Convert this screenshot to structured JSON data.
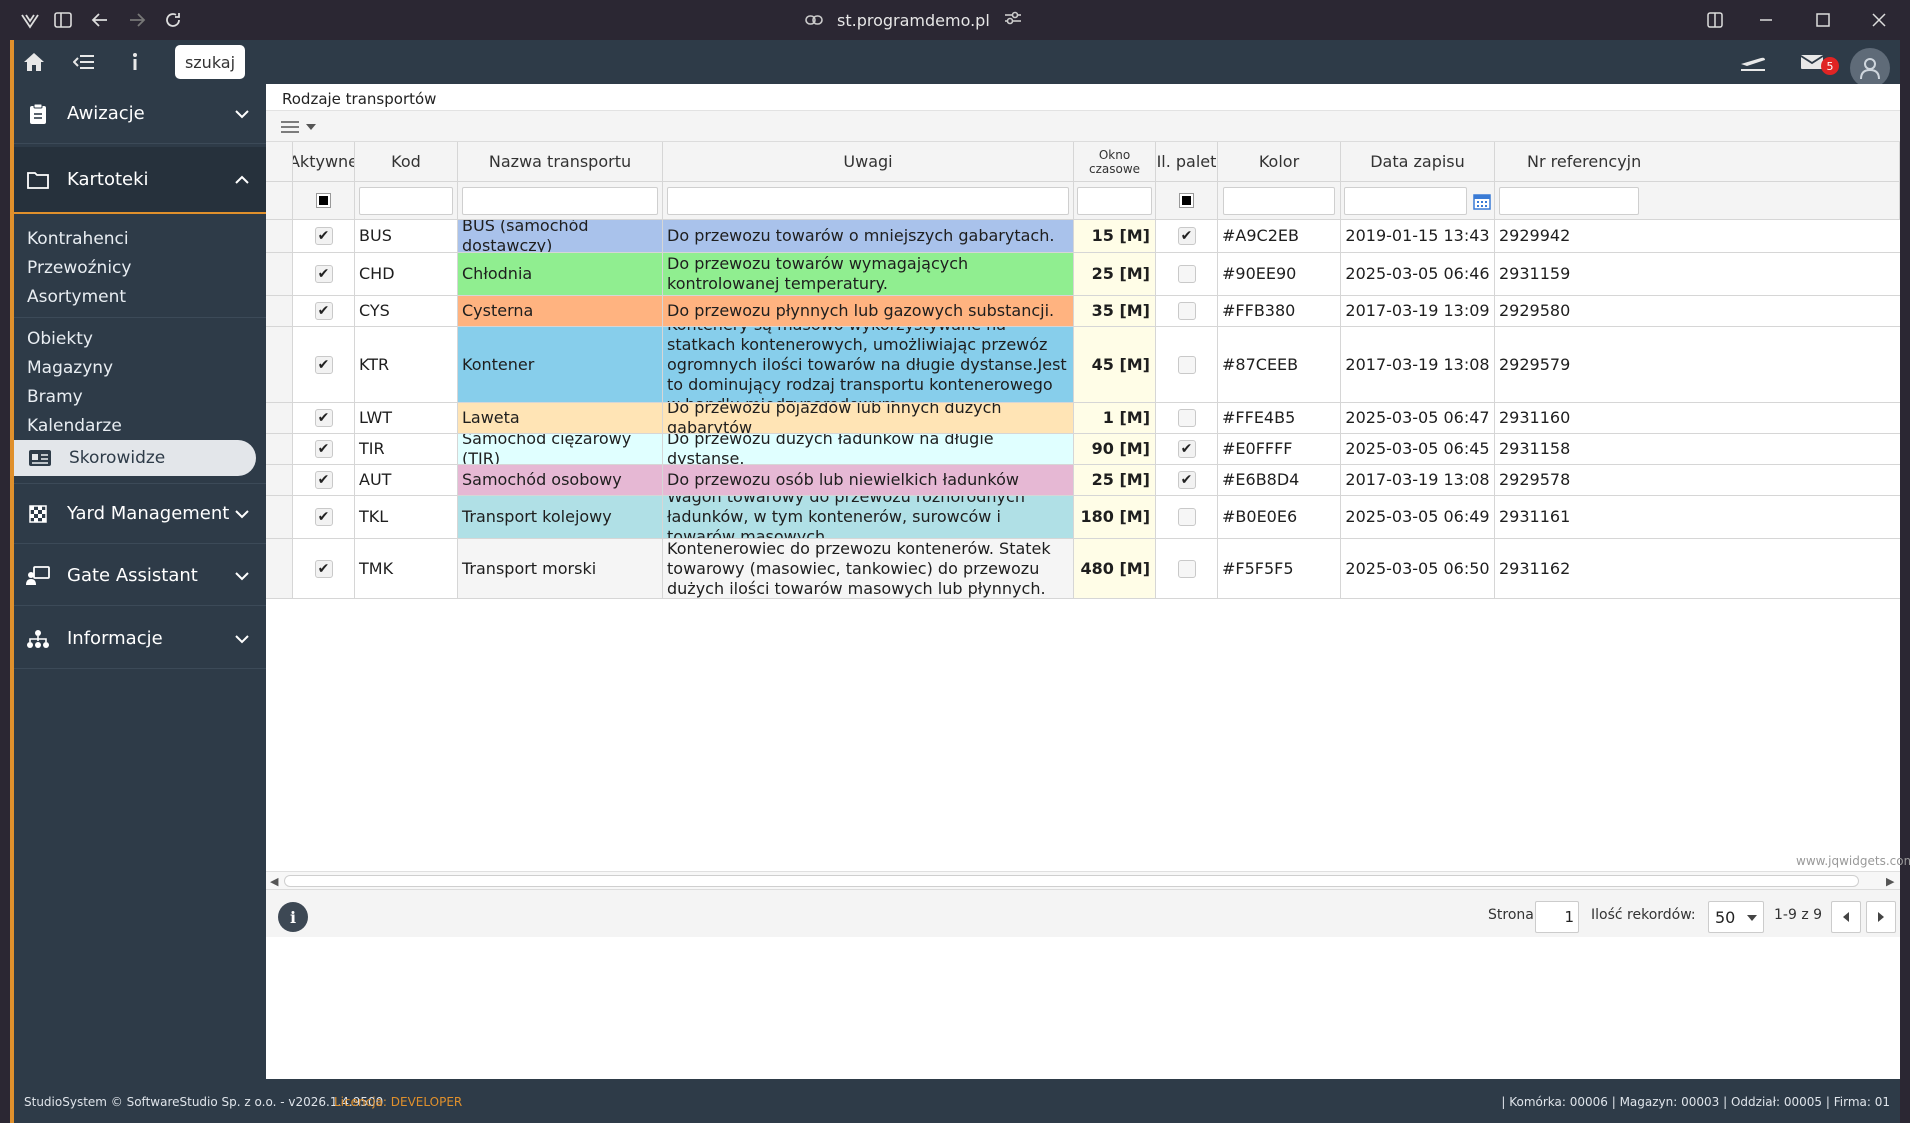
{
  "browser": {
    "url": "st.programdemo.pl"
  },
  "topbar": {
    "search_label": "szukaj",
    "mail_count": "5"
  },
  "sidebar": {
    "sections": [
      {
        "label": "Awizacje",
        "icon": "clipboard-icon"
      },
      {
        "label": "Kartoteki",
        "icon": "folder-icon"
      },
      {
        "label": "Yard Management",
        "icon": "checker-icon"
      },
      {
        "label": "Gate Assistant",
        "icon": "gate-icon"
      },
      {
        "label": "Informacje",
        "icon": "hierarchy-icon"
      }
    ],
    "kartoteki_items": [
      "Kontrahenci",
      "Przewoźnicy",
      "Asortyment",
      "Obiekty",
      "Magazyny",
      "Bramy",
      "Kalendarze"
    ],
    "active_item": "Skorowidze"
  },
  "page": {
    "title": "Rodzaje transportów"
  },
  "grid": {
    "columns": [
      "Aktywne",
      "Kod",
      "Nazwa transportu",
      "Uwagi",
      "Okno czasowe",
      "Il. palet",
      "Kolor",
      "Data zapisu",
      "Nr referencyjn"
    ],
    "rows": [
      {
        "aktywne": true,
        "kod": "BUS",
        "nazwa": "BUS (samochód dostawczy)",
        "uwagi": "Do przewozu towarów o mniejszych gabarytach.",
        "okno": "15 [M]",
        "palety": true,
        "kolor": "#A9C2EB",
        "data": "2019-01-15 13:43",
        "nr": "2929942"
      },
      {
        "aktywne": true,
        "kod": "CHD",
        "nazwa": "Chłodnia",
        "uwagi": "Do przewozu towarów wymagających kontrolowanej temperatury.",
        "okno": "25 [M]",
        "palety": false,
        "kolor": "#90EE90",
        "data": "2025-03-05 06:46",
        "nr": "2931159"
      },
      {
        "aktywne": true,
        "kod": "CYS",
        "nazwa": "Cysterna",
        "uwagi": "Do przewozu płynnych lub gazowych substancji.",
        "okno": "35 [M]",
        "palety": false,
        "kolor": "#FFB380",
        "data": "2017-03-19 13:09",
        "nr": "2929580"
      },
      {
        "aktywne": true,
        "kod": "KTR",
        "nazwa": "Kontener",
        "uwagi": "Kontenery są masowo wykorzystywane na statkach kontenerowych, umożliwiając przewóz ogromnych ilości towarów na długie dystanse.Jest to dominujący rodzaj transportu kontenerowego w handlu międzynarodowym.",
        "okno": "45 [M]",
        "palety": false,
        "kolor": "#87CEEB",
        "data": "2017-03-19 13:08",
        "nr": "2929579"
      },
      {
        "aktywne": true,
        "kod": "LWT",
        "nazwa": "Laweta",
        "uwagi": "Do przewozu pojazdów lub innych dużych gabarytów",
        "okno": "1 [M]",
        "palety": false,
        "kolor": "#FFE4B5",
        "data": "2025-03-05 06:47",
        "nr": "2931160"
      },
      {
        "aktywne": true,
        "kod": "TIR",
        "nazwa": "Samochód ciężarowy (TIR)",
        "uwagi": "Do przewozu dużych ładunków na długie dystanse.",
        "okno": "90 [M]",
        "palety": true,
        "kolor": "#E0FFFF",
        "data": "2025-03-05 06:45",
        "nr": "2931158"
      },
      {
        "aktywne": true,
        "kod": "AUT",
        "nazwa": "Samochód osobowy",
        "uwagi": "Do przewozu osób lub niewielkich ładunków",
        "okno": "25 [M]",
        "palety": true,
        "kolor": "#E6B8D4",
        "data": "2017-03-19 13:08",
        "nr": "2929578"
      },
      {
        "aktywne": true,
        "kod": "TKL",
        "nazwa": "Transport kolejowy",
        "uwagi": "Wagon towarowy do przewozu różnorodnych ładunków, w tym kontenerów, surowców i towarów masowych.",
        "okno": "180 [M]",
        "palety": false,
        "kolor": "#B0E0E6",
        "data": "2025-03-05 06:49",
        "nr": "2931161"
      },
      {
        "aktywne": true,
        "kod": "TMK",
        "nazwa": "Transport morski",
        "uwagi": "Kontenerowiec do przewozu kontenerów. Statek towarowy (masowiec, tankowiec) do przewozu dużych ilości towarów masowych lub płynnych.",
        "okno": "480 [M]",
        "palety": false,
        "kolor": "#F5F5F5",
        "data": "2025-03-05 06:50",
        "nr": "2931162"
      }
    ],
    "watermark": "www.jqwidgets.com"
  },
  "pager": {
    "page_label": "Strona:",
    "page_value": "1",
    "records_label": "Ilość rekordów:",
    "records_value": "50",
    "range": "1-9 z 9"
  },
  "footer": {
    "copyright": "StudioSystem © SoftwareStudio Sp. z o.o. - v2026.1.4.9500",
    "license_label": "Licencja:",
    "license_value": "DEVELOPER",
    "status": "| Komórka: 00006 | Magazyn: 00003 | Oddział: 00005 | Firma: 01"
  }
}
